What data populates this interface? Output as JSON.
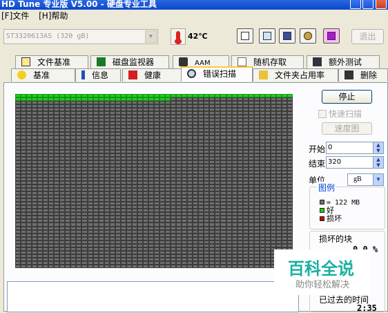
{
  "window": {
    "title": "HD Tune 专业版 V5.00 - 硬盘专业工具"
  },
  "menu": {
    "items": [
      "[F]文件",
      "[H]帮助"
    ]
  },
  "toolbar": {
    "drive": "ST3320613AS (320 gB)",
    "temperature": "42℃",
    "exit_label": "退出",
    "buttons": [
      "copy-text-icon",
      "copy-screen-icon",
      "save-icon",
      "options-icon",
      "download-icon"
    ]
  },
  "tabs": {
    "row1": [
      "文件基准",
      "磁盘监视器",
      "AAM",
      "随机存取",
      "额外测试"
    ],
    "row2": [
      "基准",
      "信息",
      "健康",
      "错误扫描",
      "文件夹占用率",
      "删除"
    ],
    "active": "错误扫描"
  },
  "scan": {
    "stop_label": "停止",
    "quick_scan_label": "快速扫描",
    "speed_map_label": "速度图",
    "start_label": "开始",
    "start_value": "0",
    "end_label": "结束",
    "end_value": "320",
    "unit_label": "单位",
    "unit_value": "gB",
    "legend_title": "图例",
    "legend_block": "= 122 MB",
    "legend_good": "好",
    "legend_damaged": "损坏",
    "damaged_blocks_label": "损坏的块",
    "damaged_blocks_value": "0.0 %",
    "elapsed_label": "已过去的时间",
    "elapsed_value": "2:35",
    "grid": {
      "columns": 50,
      "rows": 50,
      "scanned_blocks": 78
    }
  },
  "watermark": {
    "title": "百科全说",
    "subtitle": "助你轻松解决"
  },
  "colors": {
    "good": "#22cc22",
    "damaged": "#cc0000",
    "block": "#6f6f6f",
    "accent": "#0046d5"
  }
}
